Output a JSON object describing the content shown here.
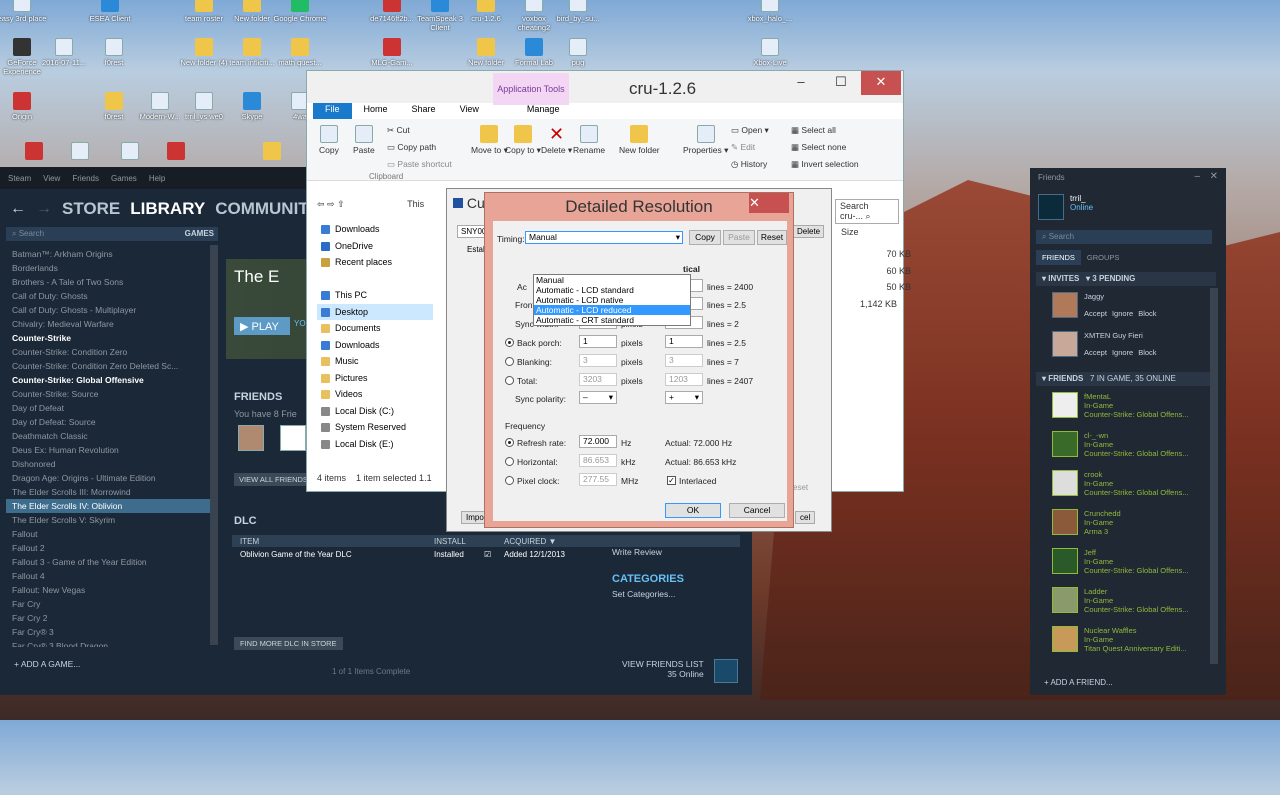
{
  "desktop": {
    "icons": [
      {
        "label": "easy 3rd place",
        "kind": "p"
      },
      {
        "label": "ESEA Client",
        "kind": "b"
      },
      {
        "label": "team roster",
        "kind": "f"
      },
      {
        "label": "New folder",
        "kind": "f"
      },
      {
        "label": "Google Chrome",
        "kind": "g"
      },
      {
        "label": "de7146ff2b...",
        "kind": "r"
      },
      {
        "label": "TeamSpeak 3 Client",
        "kind": "b"
      },
      {
        "label": "cru-1.2.6",
        "kind": "f"
      },
      {
        "label": "voxbox cheating2",
        "kind": "p"
      },
      {
        "label": "bird_by_su...",
        "kind": "p"
      },
      {
        "label": "xbox_halo_...",
        "kind": "p"
      },
      {
        "label": "GeForce Experience",
        "kind": "k"
      },
      {
        "label": "2016-07-11...",
        "kind": "p"
      },
      {
        "label": "f0rest",
        "kind": "p"
      },
      {
        "label": "New folder (4)",
        "kind": "f"
      },
      {
        "label": "team infliciti...",
        "kind": "f"
      },
      {
        "label": "math quest...",
        "kind": "f"
      },
      {
        "label": "MLG-Gam...",
        "kind": "r"
      },
      {
        "label": "New folder",
        "kind": "f"
      },
      {
        "label": "Formal Lab",
        "kind": "b"
      },
      {
        "label": "pug",
        "kind": "p"
      },
      {
        "label": "Xbox-Live",
        "kind": "p"
      },
      {
        "label": "Origin",
        "kind": "r"
      },
      {
        "label": "f0rest",
        "kind": "f"
      },
      {
        "label": "Modern-W...",
        "kind": "p"
      },
      {
        "label": "trril_vs we0",
        "kind": "p"
      },
      {
        "label": "Skype",
        "kind": "b"
      },
      {
        "label": "4wa",
        "kind": "p"
      }
    ]
  },
  "steam": {
    "menu": [
      "Steam",
      "View",
      "Friends",
      "Games",
      "Help"
    ],
    "nav": {
      "store": "STORE",
      "library": "LIBRARY",
      "community": "COMMUNITY"
    },
    "search_placeholder": "Search",
    "games_label": "GAMES",
    "games": [
      {
        "name": "Batman™: Arkham Origins",
        "style": ""
      },
      {
        "name": "Borderlands",
        "style": ""
      },
      {
        "name": "Brothers - A Tale of Two Sons",
        "style": ""
      },
      {
        "name": "Call of Duty: Ghosts",
        "style": ""
      },
      {
        "name": "Call of Duty: Ghosts - Multiplayer",
        "style": ""
      },
      {
        "name": "Chivalry: Medieval Warfare",
        "style": ""
      },
      {
        "name": "Counter-Strike",
        "style": "hl"
      },
      {
        "name": "Counter-Strike: Condition Zero",
        "style": ""
      },
      {
        "name": "Counter-Strike: Condition Zero Deleted Sc...",
        "style": ""
      },
      {
        "name": "Counter-Strike: Global Offensive",
        "style": "hl"
      },
      {
        "name": "Counter-Strike: Source",
        "style": ""
      },
      {
        "name": "Day of Defeat",
        "style": ""
      },
      {
        "name": "Day of Defeat: Source",
        "style": ""
      },
      {
        "name": "Deathmatch Classic",
        "style": ""
      },
      {
        "name": "Deus Ex: Human Revolution",
        "style": ""
      },
      {
        "name": "Dishonored",
        "style": ""
      },
      {
        "name": "Dragon Age: Origins - Ultimate Edition",
        "style": ""
      },
      {
        "name": "The Elder Scrolls III: Morrowind",
        "style": ""
      },
      {
        "name": "The Elder Scrolls IV: Oblivion",
        "style": "sel"
      },
      {
        "name": "The Elder Scrolls V: Skyrim",
        "style": ""
      },
      {
        "name": "Fallout",
        "style": ""
      },
      {
        "name": "Fallout 2",
        "style": ""
      },
      {
        "name": "Fallout 3 - Game of the Year Edition",
        "style": ""
      },
      {
        "name": "Fallout 4",
        "style": ""
      },
      {
        "name": "Fallout: New Vegas",
        "style": ""
      },
      {
        "name": "Far Cry",
        "style": ""
      },
      {
        "name": "Far Cry 2",
        "style": ""
      },
      {
        "name": "Far Cry® 3",
        "style": ""
      },
      {
        "name": "Far Cry® 3 Blood Dragon",
        "style": ""
      }
    ],
    "add_game": "+ ADD A GAME...",
    "game_title": "The E",
    "play": "▶ PLAY",
    "play_sub": "YO",
    "friends_heading": "FRIENDS",
    "friends_text": "You have 8 Frie",
    "view_all_friends": "VIEW ALL FRIENDS",
    "dlc_heading": "DLC",
    "dlc_cols": [
      "ITEM",
      "INSTALL",
      "ACQUIRED ▼"
    ],
    "dlc_rows": [
      {
        "item": "Oblivion Game of the Year DLC",
        "install": "Installed",
        "acquired": "Added 12/1/2013"
      }
    ],
    "find_dlc": "FIND MORE DLC IN STORE",
    "items_complete": "1 of 1 Items Complete",
    "write_review": "Write Review",
    "categories": "CATEGORIES",
    "set_categories": "Set Categories...",
    "view_friends_list": "VIEW FRIENDS LIST",
    "online_count": "35 Online"
  },
  "explorer": {
    "title": "cru-1.2.6",
    "app_tools": "Application Tools",
    "tabs": [
      "File",
      "Home",
      "Share",
      "View",
      "Manage"
    ],
    "ribbon": {
      "copy": "Copy",
      "paste": "Paste",
      "cut": "Cut",
      "copy_path": "Copy path",
      "paste_shortcut": "Paste shortcut",
      "clipboard": "Clipboard",
      "move_to": "Move to ▾",
      "copy_to": "Copy to ▾",
      "delete": "Delete ▾",
      "rename": "Rename",
      "new_folder": "New folder",
      "properties": "Properties ▾",
      "open": "Open ▾",
      "edit": "Edit",
      "history": "History",
      "select_all": "Select all",
      "select_none": "Select none",
      "invert_selection": "Invert selection"
    },
    "address": "This",
    "search": "Search cru-...",
    "size_header": "Size",
    "sizes": [
      "70 KB",
      "60 KB",
      "50 KB",
      "1,142 KB"
    ],
    "nav": [
      {
        "label": "Downloads",
        "c": "#3a7bd5"
      },
      {
        "label": "OneDrive",
        "c": "#2a6ac8"
      },
      {
        "label": "Recent places",
        "c": "#c8a040"
      },
      {
        "label": "",
        "c": ""
      },
      {
        "label": "This PC",
        "c": "#3a7bd5"
      },
      {
        "label": "Desktop",
        "c": "#3a7bd5",
        "sel": true
      },
      {
        "label": "Documents",
        "c": "#e8c060"
      },
      {
        "label": "Downloads",
        "c": "#3a7bd5"
      },
      {
        "label": "Music",
        "c": "#e8c060"
      },
      {
        "label": "Pictures",
        "c": "#e8c060"
      },
      {
        "label": "Videos",
        "c": "#e8c060"
      },
      {
        "label": "Local Disk (C:)",
        "c": "#888"
      },
      {
        "label": "System Reserved",
        "c": "#888"
      },
      {
        "label": "Local Disk (E:)",
        "c": "#888"
      }
    ],
    "status_items": "4 items",
    "status_selected": "1 item selected 1.1"
  },
  "cu": {
    "title": "Cu",
    "monitor": "SNY00",
    "delete": "Delete",
    "estab": "Estal",
    "param": "Parar",
    "import": "Impo",
    "reset": "eset",
    "ok2": "cel"
  },
  "dialog": {
    "title": "Detailed Resolution",
    "timing_label": "Timing:",
    "timing_value": "Manual",
    "copy": "Copy",
    "paste": "Paste",
    "reset": "Reset",
    "options": [
      "Manual",
      "Automatic - LCD standard",
      "Automatic - LCD native",
      "Automatic - LCD reduced",
      "Automatic - CRT standard"
    ],
    "selected_option": 3,
    "vertical_header": "tical",
    "rows": [
      {
        "label": "Front porch:",
        "h": "1",
        "v": "1",
        "lines": "lines = 2.5",
        "radio": false
      },
      {
        "label": "Sync width:",
        "h": "1",
        "v": "1",
        "lines": "lines = 2",
        "radio": false
      },
      {
        "label": "Back porch:",
        "h": "1",
        "v": "1",
        "lines": "lines = 2.5",
        "radio": true,
        "on": true
      },
      {
        "label": "Blanking:",
        "h": "3",
        "v": "3",
        "lines": "lines = 7",
        "radio": true,
        "dis": true
      },
      {
        "label": "Total:",
        "h": "3203",
        "v": "1203",
        "lines": "lines = 2407",
        "radio": true,
        "dis": true
      }
    ],
    "first_v": "0",
    "first_lines": "lines = 2400",
    "active_h": "Ac",
    "pixels": "pixels",
    "sync_polarity": "Sync polarity:",
    "h_pol": "–",
    "v_pol": "+",
    "frequency": "Frequency",
    "refresh_label": "Refresh rate:",
    "refresh_value": "72.000",
    "hz": "Hz",
    "actual_refresh": "Actual: 72.000 Hz",
    "horizontal_label": "Horizontal:",
    "horizontal_value": "86.653",
    "khz": "kHz",
    "actual_horizontal": "Actual: 86.653 kHz",
    "pixel_label": "Pixel clock:",
    "pixel_value": "277.55",
    "mhz": "MHz",
    "interlaced": "Interlaced",
    "ok": "OK",
    "cancel": "Cancel"
  },
  "friends": {
    "title": "Friends",
    "me": {
      "name": "trril_",
      "status": "Online"
    },
    "search_placeholder": "Search",
    "tabs": [
      "FRIENDS",
      "GROUPS"
    ],
    "invites_label": "INVITES",
    "pending": "3 PENDING",
    "invites": [
      {
        "name": "Jaggy"
      },
      {
        "name": "XMTEN Guy Fieri"
      }
    ],
    "accept": "Accept",
    "ignore": "Ignore",
    "block": "Block",
    "friends_label": "FRIENDS",
    "friends_count": "7 IN GAME, 35 ONLINE",
    "list": [
      {
        "name": "fMentaL",
        "st": "In-Game",
        "game": "Counter-Strike: Global Offens..."
      },
      {
        "name": "cl-_-wn",
        "st": "In-Game",
        "game": "Counter-Strike: Global Offens..."
      },
      {
        "name": "crook",
        "st": "In-Game",
        "game": "Counter-Strike: Global Offens..."
      },
      {
        "name": "Crunchedd",
        "st": "In-Game",
        "game": "Arma 3"
      },
      {
        "name": "Jeff",
        "st": "In-Game",
        "game": "Counter-Strike: Global Offens..."
      },
      {
        "name": "Ladder",
        "st": "In-Game",
        "game": "Counter-Strike: Global Offens..."
      },
      {
        "name": "Nuclear Waffles",
        "st": "In-Game",
        "game": "Titan Quest Anniversary Editi..."
      }
    ],
    "add_friend": "+ ADD A FRIEND..."
  }
}
